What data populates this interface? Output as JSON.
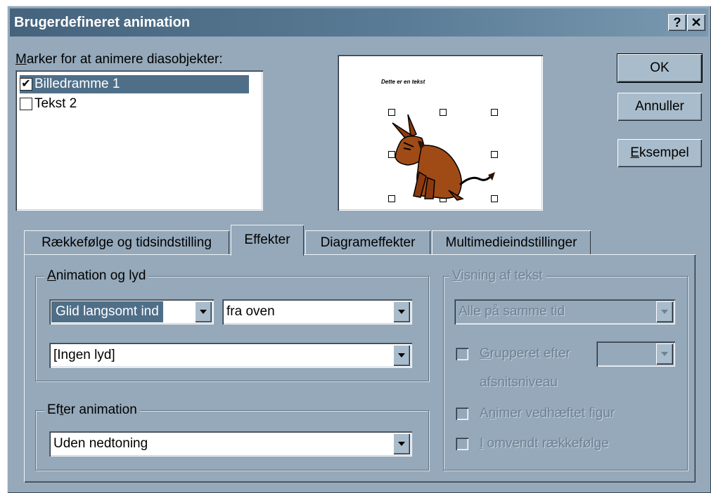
{
  "window": {
    "title": "Brugerdefineret animation",
    "help_button": "?",
    "close_button": "✕"
  },
  "objects": {
    "label_prefix": "M",
    "label_rest": "arker for at animere diasobjekter:",
    "items": [
      {
        "label": "Billedramme 1",
        "checked": true,
        "check_mark": "✔"
      },
      {
        "label": "Tekst 2",
        "checked": false,
        "check_mark": ""
      }
    ]
  },
  "preview": {
    "slide_text": "Dette er en tekst",
    "image": "donkey-clipart"
  },
  "buttons": {
    "ok": "OK",
    "cancel": "Annuller",
    "example_prefix": "E",
    "example_rest": "ksempel"
  },
  "tabs": [
    {
      "label": "Rækkefølge og tidsindstilling",
      "active": false
    },
    {
      "label": "Effekter",
      "active": true
    },
    {
      "label": "Diagrameffekter",
      "active": false
    },
    {
      "label": "Multimedieindstillinger",
      "active": false
    }
  ],
  "animation_sound": {
    "legend_prefix": "A",
    "legend_rest": "nimation og lyd",
    "effect": "Glid langsomt ind",
    "direction": "fra oven",
    "sound": "[Ingen lyd]"
  },
  "after_animation": {
    "legend_a": "Ef",
    "legend_ul": "t",
    "legend_b": "er animation",
    "value": "Uden nedtoning"
  },
  "text_display": {
    "legend_prefix": "V",
    "legend_rest": "isning af tekst",
    "mode": "Alle på samme tid",
    "grouped_prefix": "G",
    "grouped_rest": "rupperet efter",
    "grouped_line2": "afsnitsniveau",
    "attached_a": "A",
    "attached_ul": "n",
    "attached_b": "imer vedhæftet figur",
    "reverse_prefix": "I",
    "reverse_rest": " omvendt rækkefølge"
  },
  "colors": {
    "dialog_bg": "#95a9ba",
    "titlebar": "#45637c",
    "selection": "#4f6f89"
  }
}
